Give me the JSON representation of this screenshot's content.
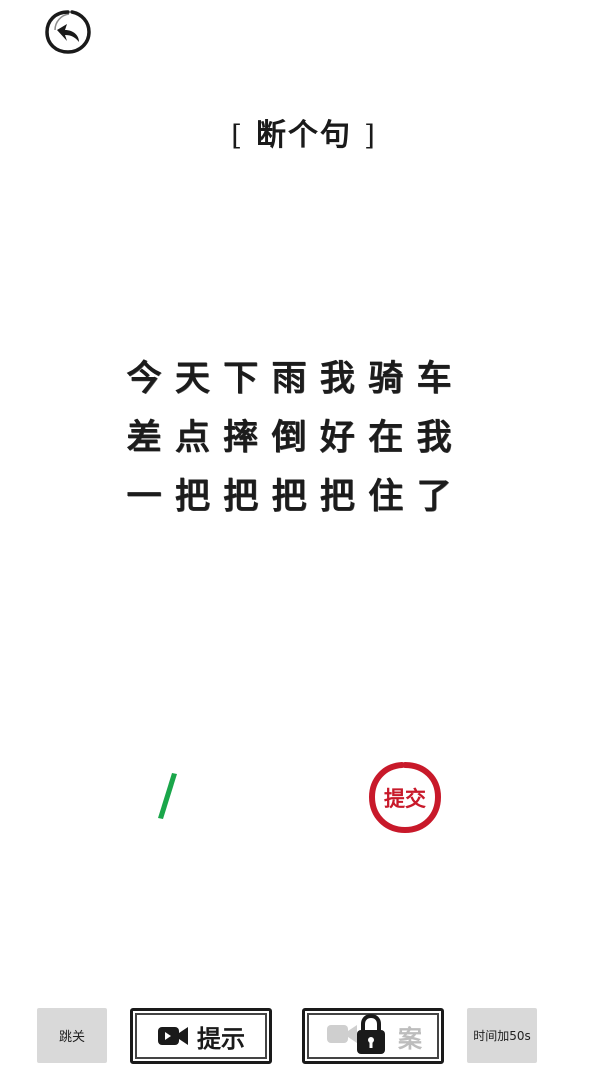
{
  "title": {
    "open_bracket": "[",
    "text": "断个句",
    "close_bracket": "]"
  },
  "puzzle": {
    "lines": [
      [
        "今",
        "天",
        "下",
        "雨",
        "我",
        "骑",
        "车"
      ],
      [
        "差",
        "点",
        "摔",
        "倒",
        "好",
        "在",
        "我"
      ],
      [
        "一",
        "把",
        "把",
        "把",
        "把",
        "住",
        "了"
      ]
    ]
  },
  "input_mark": "/",
  "submit": {
    "label": "提交"
  },
  "bottom": {
    "skip_label": "跳关",
    "hint_label": "提示",
    "answer_label": "案",
    "time_label": "时间加50s"
  },
  "colors": {
    "accent_red": "#c8192a",
    "mark_green": "#1aa64a",
    "ink": "#1a1a1a",
    "button_gray": "#d9d9d9"
  },
  "icons": {
    "back": "back-arrow-icon",
    "hint_video": "video-camera-icon",
    "answer_video": "video-camera-icon",
    "answer_lock": "lock-icon"
  }
}
